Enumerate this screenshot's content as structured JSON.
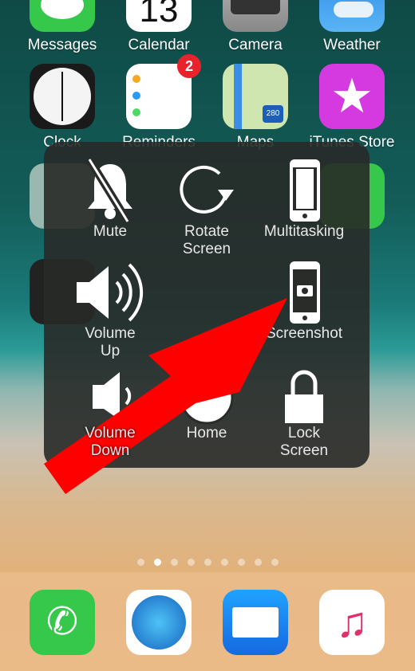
{
  "apps": [
    {
      "label": "Messages",
      "color": "#35c84a"
    },
    {
      "label": "Calendar",
      "color": "#ffffff",
      "date": "13"
    },
    {
      "label": "Camera",
      "color": "#9a9a9a"
    },
    {
      "label": "Weather",
      "color": "#3a9ff0"
    },
    {
      "label": "Clock",
      "color": "#1a1a1a"
    },
    {
      "label": "Reminders",
      "color": "#ffffff",
      "badge": "2"
    },
    {
      "label": "Maps",
      "color": "#dfe8d0",
      "shield": "280"
    },
    {
      "label": "iTunes Store",
      "color": "#d43ae0"
    }
  ],
  "assistive_menu": {
    "items": [
      {
        "label": "Mute",
        "icon": "bell-slash-icon"
      },
      {
        "label": "Rotate\nScreen",
        "icon": "rotate-icon"
      },
      {
        "label": "Multitasking",
        "icon": "multitasking-icon"
      },
      {
        "label": "Volume\nUp",
        "icon": "volume-up-icon"
      },
      {
        "label": "Screenshot",
        "icon": "screenshot-icon"
      },
      {
        "label": "Volume\nDown",
        "icon": "volume-down-icon"
      },
      {
        "label": "Home",
        "icon": "home-icon"
      },
      {
        "label": "Lock\nScreen",
        "icon": "lock-icon"
      }
    ]
  },
  "page_dots": {
    "count": 9,
    "active": 1
  },
  "dock": [
    {
      "name": "Phone",
      "color": "#35c84a"
    },
    {
      "name": "Safari",
      "color": "#ffffff"
    },
    {
      "name": "Mail",
      "color": "#1f8ff0"
    },
    {
      "name": "Music",
      "color": "#ffffff"
    }
  ],
  "annotation": {
    "arrow_color": "#ff0000"
  }
}
